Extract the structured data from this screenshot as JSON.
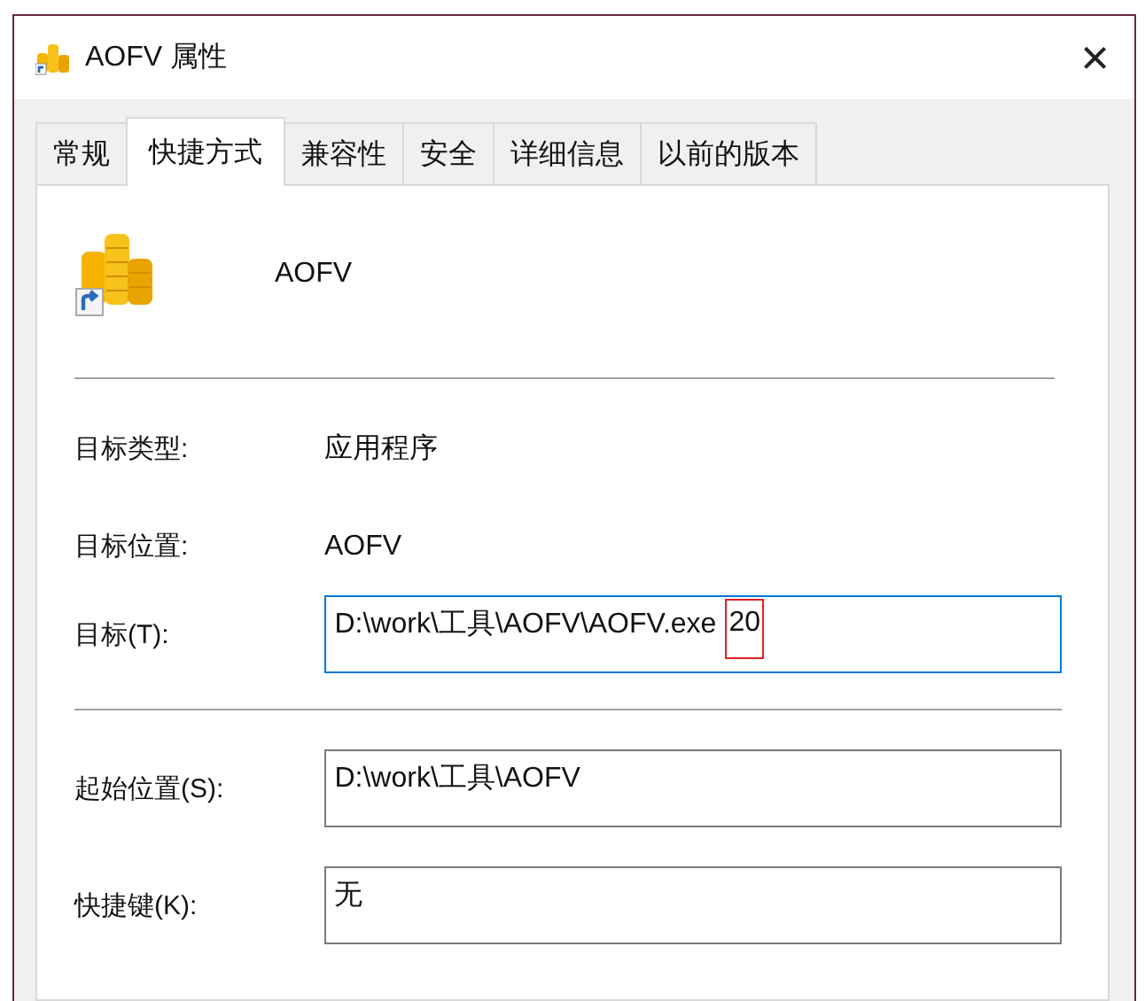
{
  "window": {
    "title": "AOFV 属性",
    "close": "×"
  },
  "tabs": [
    {
      "label": "常规",
      "selected": false
    },
    {
      "label": "快捷方式",
      "selected": true
    },
    {
      "label": "兼容性",
      "selected": false
    },
    {
      "label": "安全",
      "selected": false
    },
    {
      "label": "详细信息",
      "selected": false
    },
    {
      "label": "以前的版本",
      "selected": false
    }
  ],
  "shortcut": {
    "name": "AOFV"
  },
  "properties": [
    {
      "kind": "info",
      "label": "目标类型:",
      "value": "应用程序"
    },
    {
      "kind": "info",
      "label": "目标位置:",
      "value": "AOFV"
    },
    {
      "kind": "field",
      "label": "目标(T):",
      "value": "D:\\work\\工具\\AOFV\\AOFV.exe",
      "highlight": "20",
      "focused": true
    },
    {
      "kind": "divider"
    },
    {
      "kind": "field",
      "label": "起始位置(S):",
      "value": "D:\\work\\工具\\AOFV",
      "focused": false
    },
    {
      "kind": "field",
      "label": "快捷键(K):",
      "value": "无",
      "focused": false
    }
  ]
}
